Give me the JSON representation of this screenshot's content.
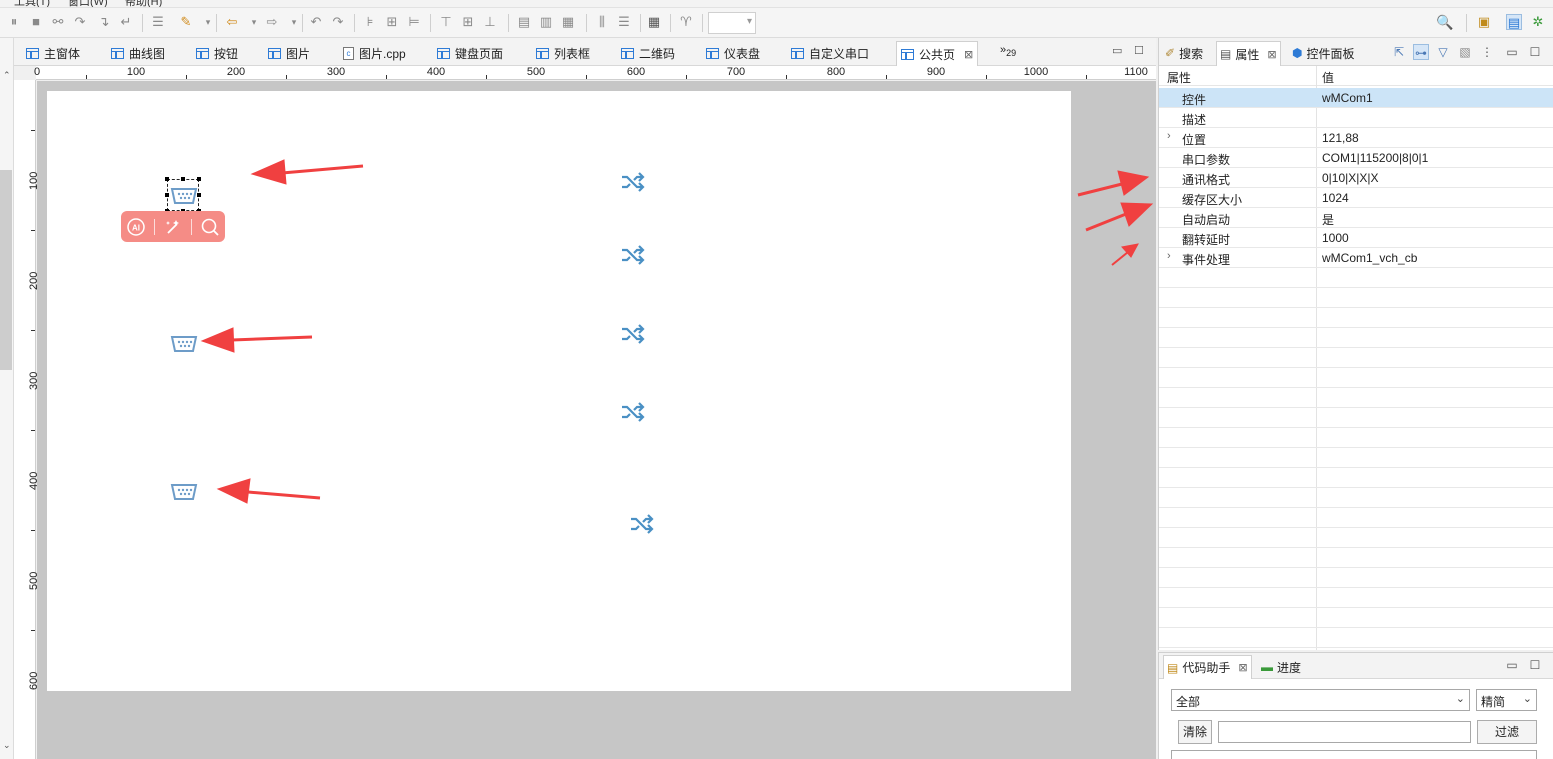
{
  "menu": {
    "items": [
      "工具(T)",
      "窗口(W)",
      "帮助(H)"
    ]
  },
  "toolbar": {
    "combo_value": ""
  },
  "editor": {
    "tabs": [
      {
        "label": "主窗体",
        "icon": "grid-icon"
      },
      {
        "label": "曲线图",
        "icon": "grid-icon"
      },
      {
        "label": "按钮",
        "icon": "grid-icon"
      },
      {
        "label": "图片",
        "icon": "grid-icon"
      },
      {
        "label": "图片.cpp",
        "icon": "cpp-file-icon"
      },
      {
        "label": "键盘页面",
        "icon": "grid-icon"
      },
      {
        "label": "列表框",
        "icon": "grid-icon"
      },
      {
        "label": "二维码",
        "icon": "grid-icon"
      },
      {
        "label": "仪表盘",
        "icon": "grid-icon"
      },
      {
        "label": "自定义串口",
        "icon": "grid-icon"
      },
      {
        "label": "公共页",
        "icon": "grid-icon",
        "active": true
      }
    ],
    "overflow_marker": "»",
    "overflow_count": "29"
  },
  "ruler": {
    "h_labels": [
      "0",
      "100",
      "200",
      "300",
      "400",
      "500",
      "600",
      "700",
      "800",
      "900",
      "1000",
      "1100"
    ],
    "v_labels": [
      "100",
      "200",
      "300",
      "400",
      "500",
      "600"
    ]
  },
  "canvas": {
    "serial_icons": [
      "serial-port-icon",
      "serial-port-icon",
      "serial-port-icon"
    ],
    "shuffle_icons": [
      "shuffle-icon",
      "shuffle-icon",
      "shuffle-icon",
      "shuffle-icon",
      "shuffle-icon"
    ],
    "floating_toolbar": [
      "ai-icon",
      "magic-wand-icon",
      "search-icon"
    ]
  },
  "right_panel": {
    "tabs": [
      {
        "label": "搜索",
        "icon": "search-pin-icon"
      },
      {
        "label": "属性",
        "icon": "table-icon",
        "active": true
      },
      {
        "label": "控件面板",
        "icon": "cube-icon"
      }
    ],
    "header": {
      "col_prop": "属性",
      "col_value": "值"
    },
    "properties": [
      {
        "key": "控件",
        "value": "wMCom1",
        "selected": true
      },
      {
        "key": "描述",
        "value": ""
      },
      {
        "key": "位置",
        "value": "121,88",
        "expandable": true
      },
      {
        "key": "串口参数",
        "value": "COM1|115200|8|0|1"
      },
      {
        "key": "通讯格式",
        "value": "0|10|X|X|X"
      },
      {
        "key": "缓存区大小",
        "value": "1024"
      },
      {
        "key": "自动启动",
        "value": "是"
      },
      {
        "key": "翻转延时",
        "value": "1000"
      },
      {
        "key": "事件处理",
        "value": "wMCom1_vch_cb",
        "expandable": true
      }
    ],
    "empty_rows": 19
  },
  "bottom_panel": {
    "tabs": [
      {
        "label": "代码助手",
        "icon": "doc-icon",
        "active": true
      },
      {
        "label": "进度",
        "icon": "progress-icon"
      }
    ],
    "filter_combo": "全部",
    "mode_combo": "精简",
    "clear_button": "清除",
    "filter_button": "过滤",
    "filter_input": ""
  },
  "colors": {
    "accent_blue": "#2e7bd6",
    "selected_row": "#cce4f7",
    "annotation_red": "#f04040",
    "canvas_bg": "#c6c6c6",
    "icon_blue": "#4a90c4"
  }
}
